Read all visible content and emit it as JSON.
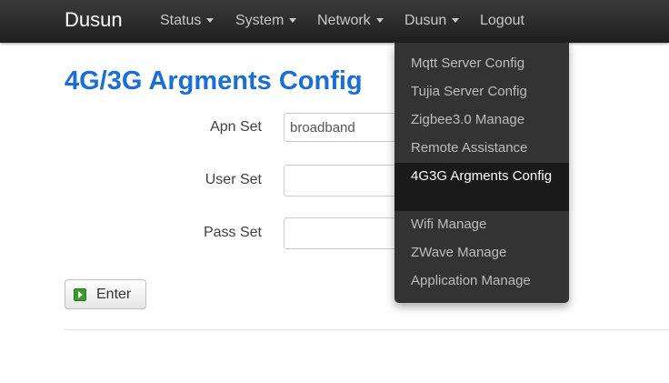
{
  "navbar": {
    "brand": "Dusun",
    "items": [
      {
        "label": "Status"
      },
      {
        "label": "System"
      },
      {
        "label": "Network"
      },
      {
        "label": "Dusun"
      },
      {
        "label": "Logout"
      }
    ]
  },
  "dropdown": {
    "items": [
      {
        "label": "Mqtt Server Config"
      },
      {
        "label": "Tujia Server Config"
      },
      {
        "label": "Zigbee3.0 Manage"
      },
      {
        "label": "Remote Assistance"
      },
      {
        "label": "4G3G Argments Config",
        "active": true
      },
      {
        "label": "Wifi Manage"
      },
      {
        "label": "ZWave Manage"
      },
      {
        "label": "Application Manage"
      }
    ]
  },
  "page": {
    "title": "4G/3G Argments Config"
  },
  "form": {
    "apn": {
      "label": "Apn Set",
      "value": "broadband"
    },
    "user": {
      "label": "User Set",
      "value": ""
    },
    "pass": {
      "label": "Pass Set",
      "value": ""
    },
    "enter_label": "Enter"
  },
  "colors": {
    "navbar_bg": "#2a2a2a",
    "title_blue": "#1a6ed8",
    "dropdown_bg": "#333333",
    "dropdown_active_bg": "#1a1a1a",
    "enter_icon_green": "#3a9a2a"
  },
  "icons": {
    "caret": "chevron-down-icon",
    "enter": "play-icon"
  }
}
